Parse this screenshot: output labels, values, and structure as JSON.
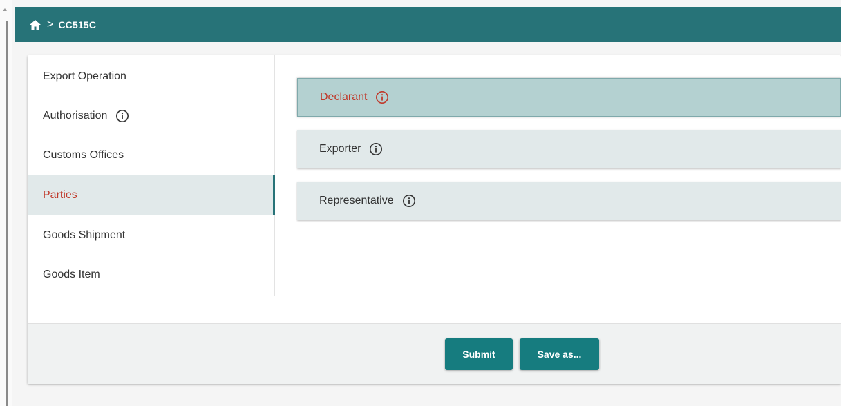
{
  "header": {
    "breadcrumb_separator": ">",
    "current_page": "CC515C"
  },
  "sidebar": {
    "items": [
      {
        "label": "Export Operation",
        "has_info": false,
        "active": false
      },
      {
        "label": "Authorisation",
        "has_info": true,
        "active": false
      },
      {
        "label": "Customs Offices",
        "has_info": false,
        "active": false
      },
      {
        "label": "Parties",
        "has_info": false,
        "active": true
      },
      {
        "label": "Goods Shipment",
        "has_info": false,
        "active": false
      },
      {
        "label": "Goods Item",
        "has_info": false,
        "active": false
      }
    ]
  },
  "panels": [
    {
      "label": "Declarant",
      "icon": "info-icon",
      "active": true
    },
    {
      "label": "Exporter",
      "icon": "info-icon",
      "active": false
    },
    {
      "label": "Representative",
      "icon": "info-icon",
      "active": false
    }
  ],
  "footer": {
    "submit_label": "Submit",
    "save_as_label": "Save as..."
  },
  "colors": {
    "header_bg": "#277378",
    "accent": "#167c7f",
    "error_red": "#c0392b",
    "active_bg": "#e1e9ea",
    "active_panel_bg": "#b4d1d1"
  }
}
